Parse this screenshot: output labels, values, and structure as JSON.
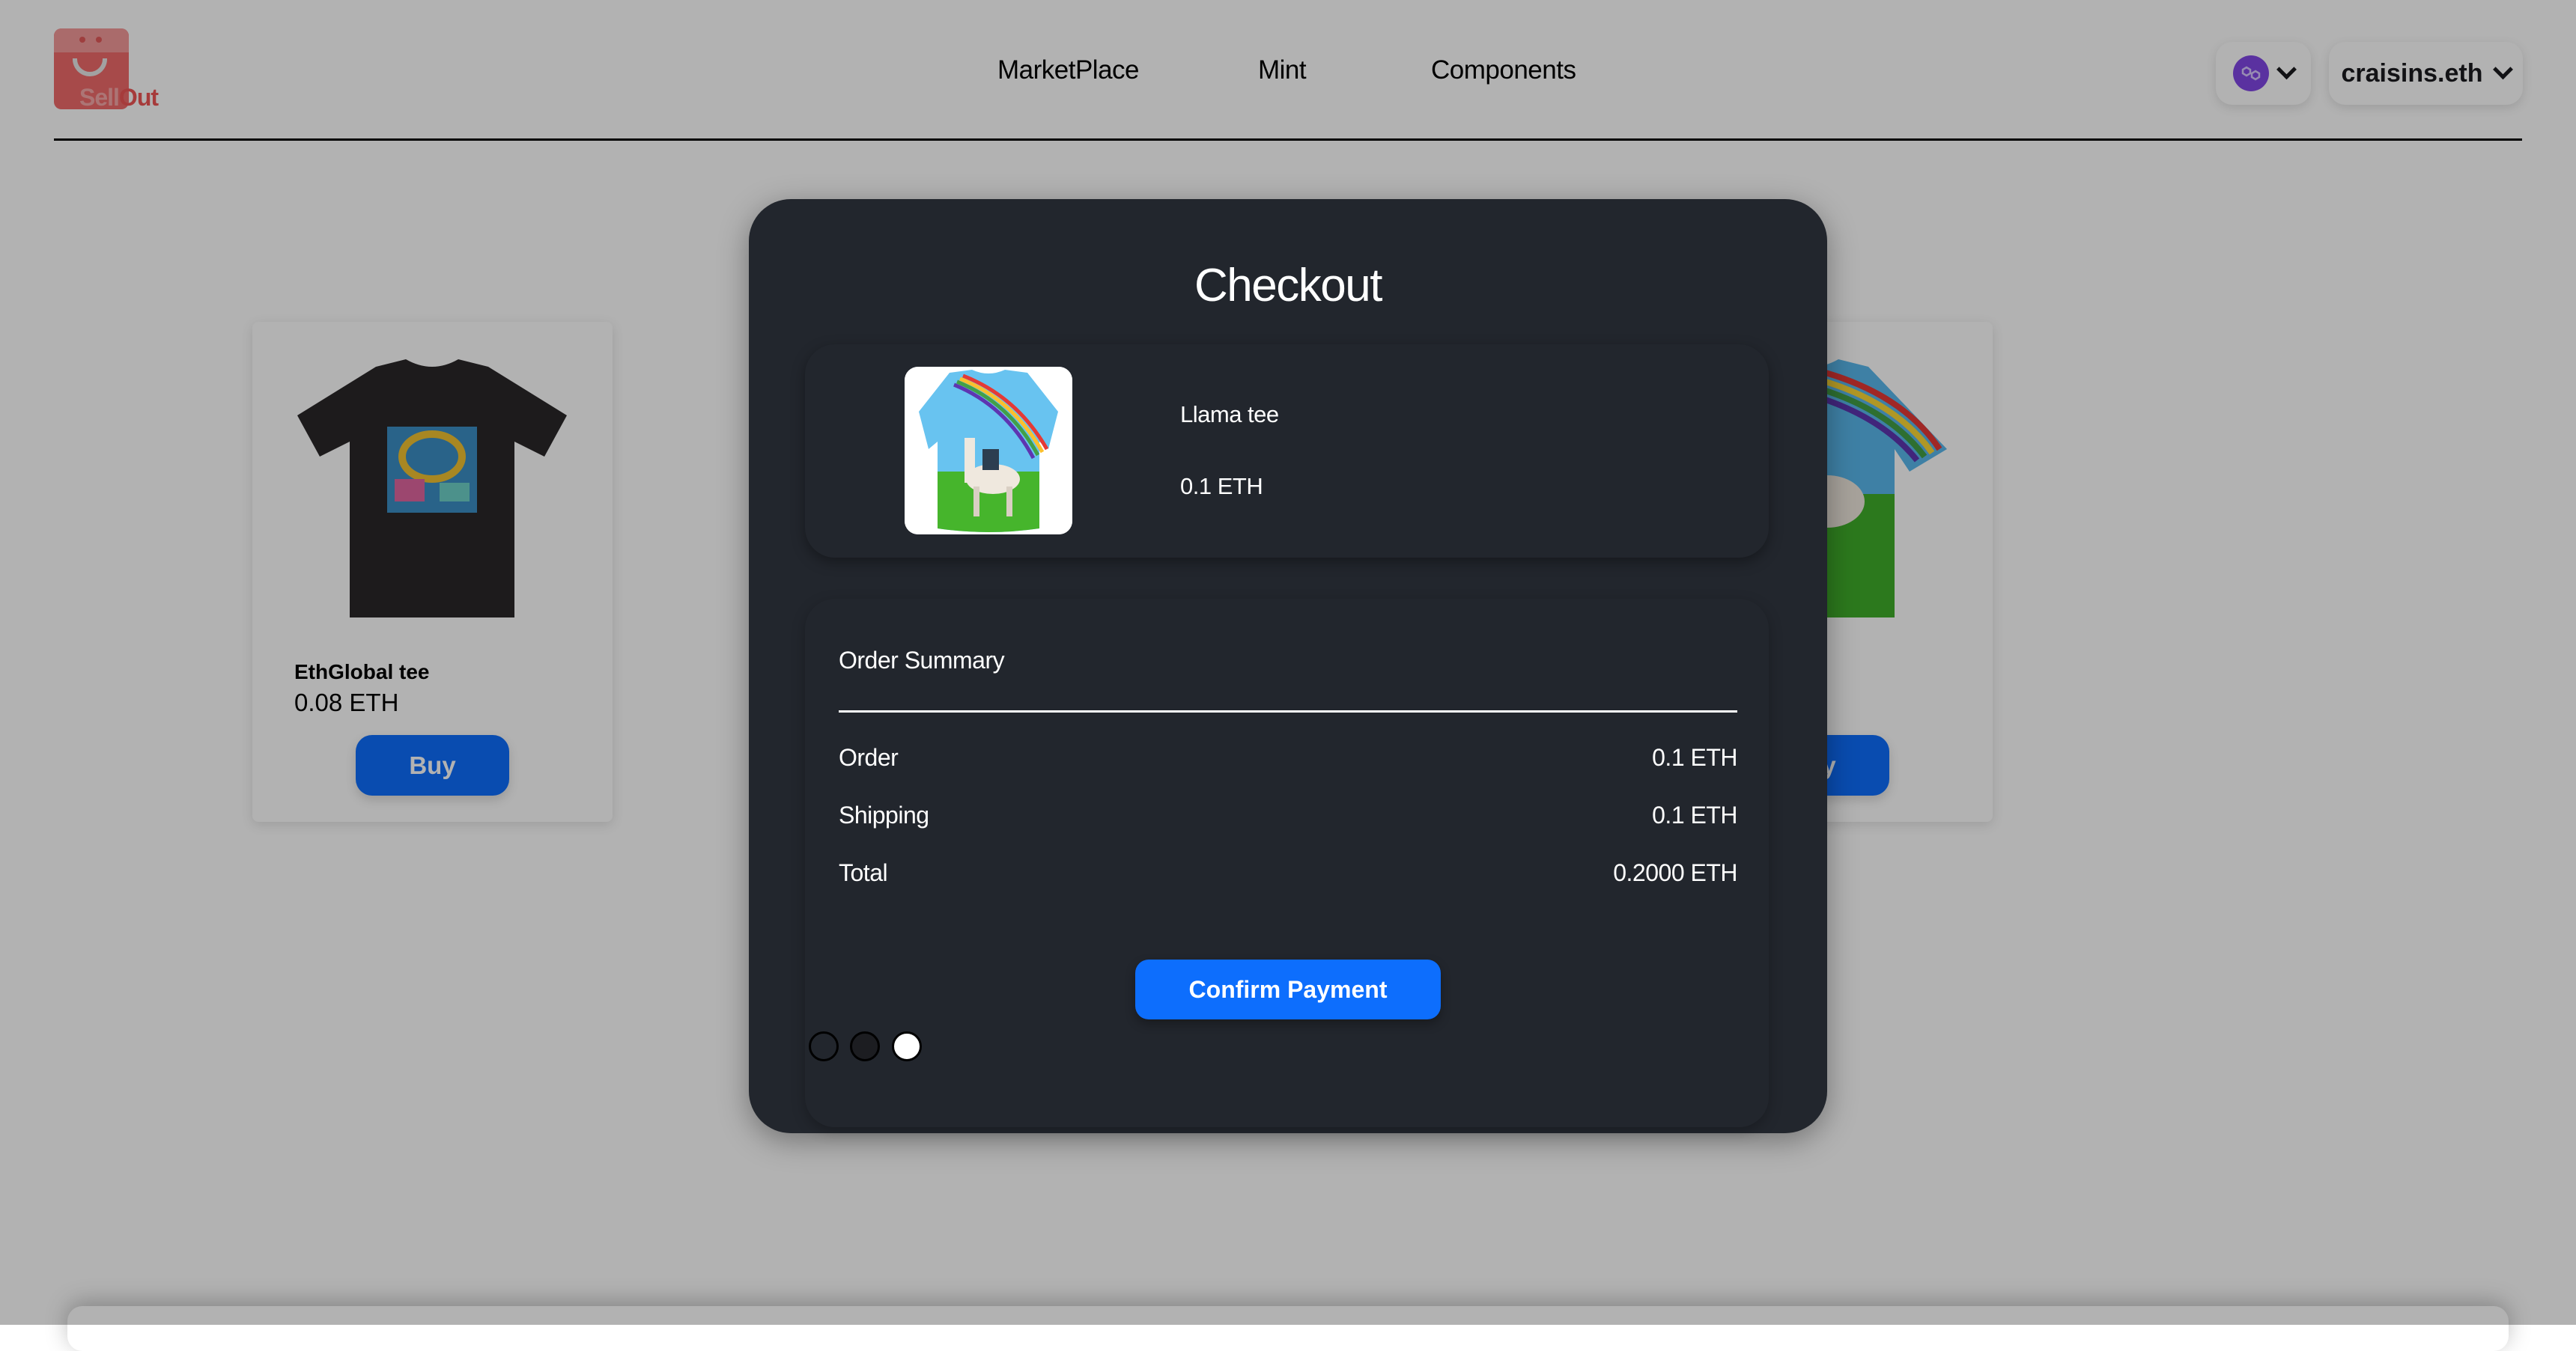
{
  "header": {
    "logo": {
      "part1": "Sell",
      "part2": "Out"
    },
    "nav": [
      {
        "label": "MarketPlace"
      },
      {
        "label": "Mint"
      },
      {
        "label": "Components"
      }
    ],
    "chain": {
      "icon": "polygon-icon",
      "color": "#8247e5"
    },
    "account": {
      "name": "craisins.eth"
    }
  },
  "products": [
    {
      "name": "EthGlobal tee",
      "price": "0.08 ETH",
      "buy_label": "Buy"
    },
    {
      "name": "Llama tee",
      "price": "0.1 ETH",
      "buy_label": "Buy"
    }
  ],
  "checkout": {
    "title": "Checkout",
    "item": {
      "name": "Llama tee",
      "price": "0.1 ETH"
    },
    "summary": {
      "title": "Order Summary",
      "rows": [
        {
          "label": "Order",
          "value": "0.1 ETH"
        },
        {
          "label": "Shipping",
          "value": "0.1 ETH"
        },
        {
          "label": "Total",
          "value": "0.2000 ETH"
        }
      ]
    },
    "confirm_label": "Confirm Payment",
    "steps": {
      "total": 3,
      "current": 3
    }
  },
  "colors": {
    "accent": "#0d6efd",
    "modal_bg": "#22262d",
    "brand": "#ef6a6a"
  }
}
